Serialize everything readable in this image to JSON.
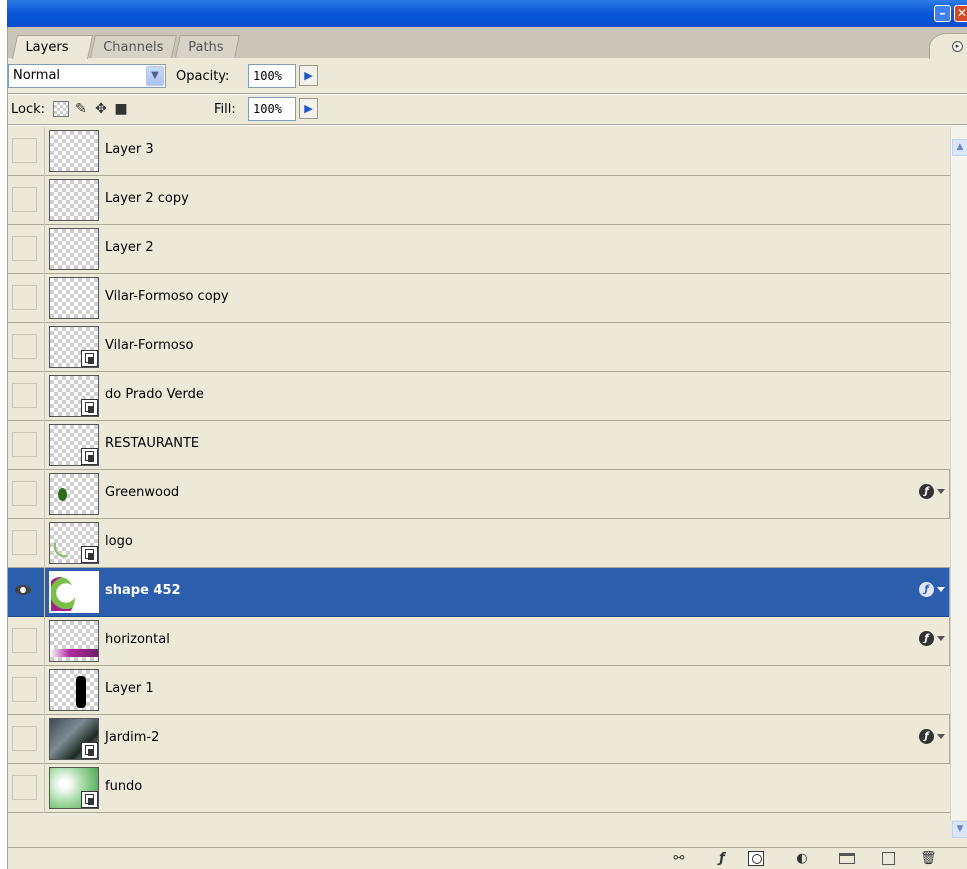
{
  "tabs": [
    {
      "label": "Layers",
      "active": true
    },
    {
      "label": "Channels",
      "active": false
    },
    {
      "label": "Paths",
      "active": false
    }
  ],
  "blend": {
    "mode": "Normal",
    "opacity_label": "Opacity:",
    "opacity_value": "100%"
  },
  "lock": {
    "label": "Lock:",
    "fill_label": "Fill:",
    "fill_value": "100%"
  },
  "layers": [
    {
      "name": "Layer 3",
      "visible": false,
      "smart": false,
      "fx": false,
      "selected": false
    },
    {
      "name": "Layer 2 copy",
      "visible": false,
      "smart": false,
      "fx": false,
      "selected": false
    },
    {
      "name": "Layer 2",
      "visible": false,
      "smart": false,
      "fx": false,
      "selected": false
    },
    {
      "name": "Vilar-Formoso copy",
      "visible": false,
      "smart": false,
      "fx": false,
      "selected": false
    },
    {
      "name": "Vilar-Formoso",
      "visible": false,
      "smart": true,
      "fx": false,
      "selected": false
    },
    {
      "name": "do Prado Verde",
      "visible": false,
      "smart": true,
      "fx": false,
      "selected": false
    },
    {
      "name": "RESTAURANTE",
      "visible": false,
      "smart": true,
      "fx": false,
      "selected": false
    },
    {
      "name": "Greenwood",
      "visible": false,
      "smart": false,
      "fx": true,
      "selected": false
    },
    {
      "name": "logo",
      "visible": false,
      "smart": true,
      "fx": false,
      "selected": false
    },
    {
      "name": "shape 452",
      "visible": true,
      "smart": false,
      "fx": true,
      "selected": true
    },
    {
      "name": "horizontal",
      "visible": false,
      "smart": false,
      "fx": true,
      "selected": false
    },
    {
      "name": "Layer 1",
      "visible": false,
      "smart": false,
      "fx": false,
      "selected": false
    },
    {
      "name": "Jardim-2",
      "visible": false,
      "smart": true,
      "fx": true,
      "selected": false
    },
    {
      "name": "fundo",
      "visible": false,
      "smart": true,
      "fx": false,
      "selected": false
    }
  ],
  "icons": {
    "bottom": [
      "link-layers-icon",
      "layer-style-icon",
      "layer-mask-icon",
      "adjustment-layer-icon",
      "new-group-icon",
      "new-layer-icon",
      "delete-layer-icon"
    ]
  },
  "colors": {
    "selection": "#2b5fad",
    "titlebar": "#0a58d8"
  }
}
